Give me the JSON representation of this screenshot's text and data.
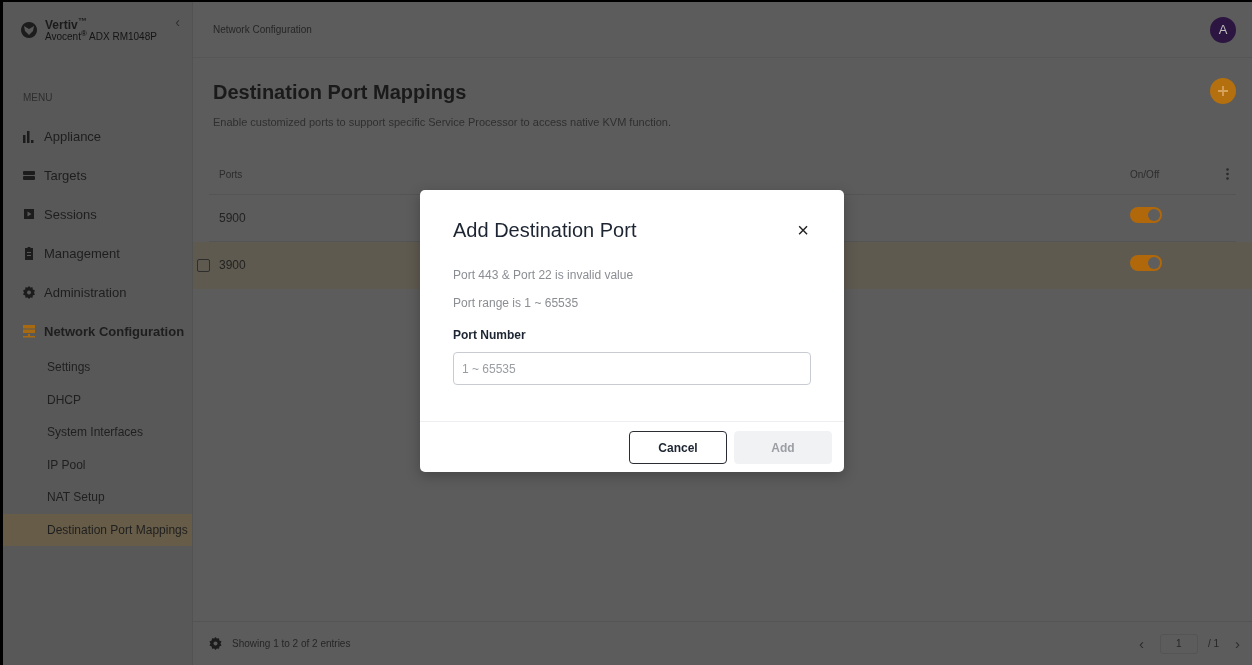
{
  "brand": {
    "name": "Vertiv$^{™}$",
    "product": "Avocent$^{®}$ ADX RM1048P",
    "collapse": "‹"
  },
  "breadcrumb": "Network Configuration",
  "user": {
    "initial": "A"
  },
  "sidebar": {
    "heading": "MENU",
    "items": [
      {
        "label": "Appliance",
        "selected": false
      },
      {
        "label": "Targets",
        "selected": false
      },
      {
        "label": "Sessions",
        "selected": false
      },
      {
        "label": "Management",
        "selected": false
      },
      {
        "label": "Administration",
        "selected": false
      },
      {
        "label": "Network Configuration",
        "selected": true,
        "expanded": true,
        "children": [
          {
            "label": "Settings",
            "selected": false
          },
          {
            "label": "DHCP",
            "selected": false
          },
          {
            "label": "System Interfaces",
            "selected": false
          },
          {
            "label": "IP Pool",
            "selected": false
          },
          {
            "label": "NAT Setup",
            "selected": false
          },
          {
            "label": "Destination Port Mappings",
            "selected": true
          }
        ]
      }
    ]
  },
  "page": {
    "title": "Destination Port Mappings",
    "description": "Enable customized ports to support specific Service Processor to access native KVM function."
  },
  "table": {
    "columns": [
      "Ports",
      "On/Off"
    ],
    "rows": [
      {
        "port": "5900",
        "on": true,
        "hovered": false,
        "checked": false
      },
      {
        "port": "3900",
        "on": true,
        "hovered": true,
        "checked": false
      }
    ]
  },
  "footer": {
    "summary": "Showing 1 to 2 of 2 entries",
    "prev": "‹",
    "page": "1",
    "of": "/  1",
    "next": "›"
  },
  "dialog": {
    "title": "Add Destination Port",
    "close": "×",
    "notes": [
      "Port 443 & Port 22 is invalid value",
      "Port range is 1 ~ 65535"
    ],
    "field": {
      "label": "Port Number",
      "placeholder": "1 ~ 65535"
    },
    "buttons": [
      {
        "label": "Cancel",
        "kind": "secondary",
        "disabled": false
      },
      {
        "label": "Add",
        "kind": "primary",
        "disabled": true
      }
    ]
  }
}
